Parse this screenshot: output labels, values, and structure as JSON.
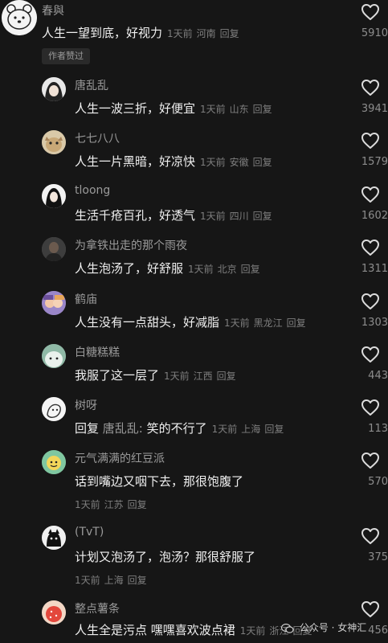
{
  "top_comment": {
    "username": "春與",
    "text": "人生一望到底，好视力",
    "time": "1天前",
    "location": "河南",
    "reply": "回复",
    "likes": "5910",
    "badge": "作者赞过"
  },
  "replies": [
    {
      "username": "唐乱乱",
      "text": "人生一波三折，好便宜",
      "time": "1天前",
      "location": "山东",
      "reply": "回复",
      "likes": "3941"
    },
    {
      "username": "七七八八",
      "text": "人生一片黑暗，好凉快",
      "time": "1天前",
      "location": "安徽",
      "reply": "回复",
      "likes": "1579"
    },
    {
      "username": "tloong",
      "text": "生活千疮百孔，好透气",
      "time": "1天前",
      "location": "四川",
      "reply": "回复",
      "likes": "1602"
    },
    {
      "username": "为拿铁出走的那个雨夜",
      "text": "人生泡汤了，好舒服",
      "time": "1天前",
      "location": "北京",
      "reply": "回复",
      "likes": "1311"
    },
    {
      "username": "鹤庙",
      "text": "人生没有一点甜头，好减脂",
      "time": "1天前",
      "location": "黑龙江",
      "reply": "回复",
      "likes": "1303"
    },
    {
      "username": "白糖糕糕",
      "text": "我服了这一层了",
      "time": "1天前",
      "location": "江西",
      "reply": "回复",
      "likes": "443"
    },
    {
      "username": "树呀",
      "reply_prefix": "回复",
      "reply_to": "唐乱乱:",
      "text": "笑的不行了",
      "time": "1天前",
      "location": "上海",
      "reply": "回复",
      "likes": "113"
    },
    {
      "username": "元气满满的红豆派",
      "text": "话到嘴边又咽下去，那很饱腹了",
      "time": "1天前",
      "location": "江苏",
      "reply": "回复",
      "likes": "570"
    },
    {
      "username": "(TvT)",
      "text": "计划又泡汤了，泡汤？那很舒服了",
      "time": "1天前",
      "location": "上海",
      "reply": "回复",
      "likes": "375"
    },
    {
      "username": "整点薯条",
      "text": "人生全是污点 嘿嘿喜欢波点裙",
      "time": "1天前",
      "location": "浙江",
      "reply": "回复",
      "likes": "456"
    }
  ],
  "watermark": "公众号 · 女神汇",
  "colors": {
    "background": "#161616",
    "text": "#f0f0f0",
    "muted": "#7e7e7e",
    "username": "#9a9a9a"
  }
}
